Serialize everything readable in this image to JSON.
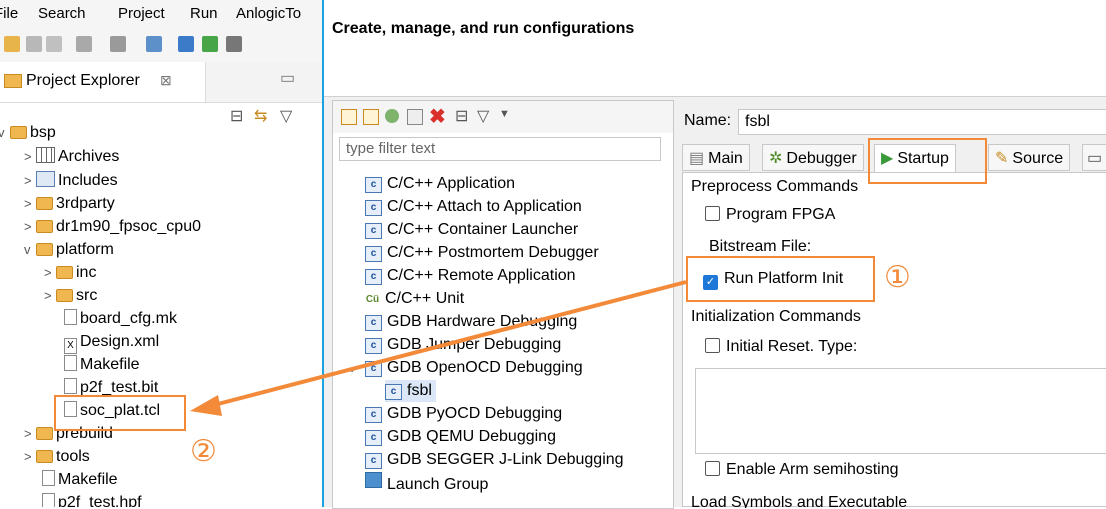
{
  "ide": {
    "menu": [
      "File",
      "Search",
      "Project",
      "Run",
      "AnlogicTo"
    ],
    "project_explorer": {
      "title": "Project Explorer",
      "tree": [
        {
          "label": "bsp",
          "twist": "v",
          "icon": "project"
        },
        {
          "label": "Archives",
          "twist": ">",
          "icon": "archive"
        },
        {
          "label": "Includes",
          "twist": ">",
          "icon": "includes"
        },
        {
          "label": "3rdparty",
          "twist": ">",
          "icon": "folder"
        },
        {
          "label": "dr1m90_fpsoc_cpu0",
          "twist": ">",
          "icon": "folder"
        },
        {
          "label": "platform",
          "twist": "v",
          "icon": "folder"
        },
        {
          "label": "inc",
          "twist": ">",
          "icon": "folder"
        },
        {
          "label": "src",
          "twist": ">",
          "icon": "folder"
        },
        {
          "label": "board_cfg.mk",
          "twist": "",
          "icon": "file"
        },
        {
          "label": "Design.xml",
          "twist": "",
          "icon": "xml"
        },
        {
          "label": "Makefile",
          "twist": "",
          "icon": "file"
        },
        {
          "label": "p2f_test.bit",
          "twist": "",
          "icon": "file"
        },
        {
          "label": "soc_plat.tcl",
          "twist": "",
          "icon": "file"
        },
        {
          "label": "prebuild",
          "twist": ">",
          "icon": "folder"
        },
        {
          "label": "tools",
          "twist": ">",
          "icon": "folder"
        },
        {
          "label": "Makefile",
          "twist": "",
          "icon": "file"
        },
        {
          "label": "p2f_test.hpf",
          "twist": "",
          "icon": "file"
        }
      ]
    }
  },
  "dialog": {
    "title": "Create, manage, and run configurations",
    "filter_placeholder": "type filter text",
    "config_types": [
      {
        "label": "C/C++ Application"
      },
      {
        "label": "C/C++ Attach to Application"
      },
      {
        "label": "C/C++ Container Launcher"
      },
      {
        "label": "C/C++ Postmortem Debugger"
      },
      {
        "label": "C/C++ Remote Application"
      },
      {
        "label": "C/C++ Unit"
      },
      {
        "label": "GDB Hardware Debugging"
      },
      {
        "label": "GDB Jumper Debugging"
      },
      {
        "label": "GDB OpenOCD Debugging"
      },
      {
        "label": "fsbl"
      },
      {
        "label": "GDB PyOCD Debugging"
      },
      {
        "label": "GDB QEMU Debugging"
      },
      {
        "label": "GDB SEGGER J-Link Debugging"
      },
      {
        "label": "Launch Group"
      }
    ],
    "name_label": "Name:",
    "name_value": "fsbl",
    "tabs": [
      "Main",
      "Debugger",
      "Startup",
      "Source"
    ],
    "startup": {
      "preprocess": "Preprocess Commands",
      "program_fpga": "Program FPGA",
      "bitstream": "Bitstream File:",
      "run_platform_init": "Run Platform Init",
      "init_commands": "Initialization Commands",
      "initial_reset": "Initial Reset.  Type:",
      "enable_semihosting": "Enable Arm semihosting",
      "load_symbols": "Load Symbols and Executable"
    }
  },
  "annotations": {
    "one": "①",
    "two": "②"
  },
  "colors": {
    "accent": "#f28a3a",
    "title_bar": "#1aa3e0"
  }
}
